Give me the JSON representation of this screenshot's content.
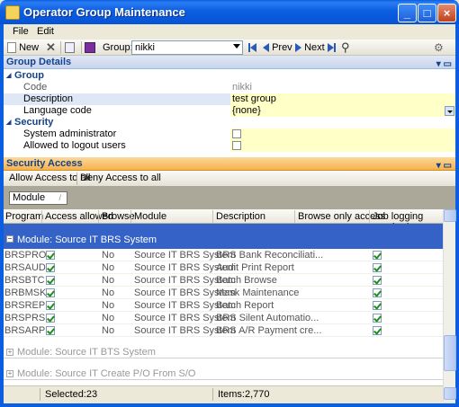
{
  "window": {
    "title": "Operator Group Maintenance"
  },
  "menu": {
    "file": "File",
    "edit": "Edit"
  },
  "toolbar": {
    "new_label": "New",
    "group_label": "Group:",
    "group_value": "nikki",
    "prev_label": "Prev",
    "next_label": "Next"
  },
  "group_details": {
    "header": "Group Details",
    "cat_group": "Group",
    "code_label": "Code",
    "code_value": "nikki",
    "desc_label": "Description",
    "desc_value": "test group",
    "lang_label": "Language code",
    "lang_value": "{none}",
    "cat_security": "Security",
    "sysadmin_label": "System administrator",
    "logout_label": "Allowed to logout users"
  },
  "security_access": {
    "header": "Security Access",
    "allow_all": "Allow Access to all",
    "deny_all": "Deny Access to all",
    "group_chip": "Module",
    "columns": [
      "Program",
      "Access allowed",
      "Browse",
      "Module",
      "Description",
      "Browse only access",
      "Job logging required"
    ],
    "group_expanded": "Module: Source IT BRS System",
    "rows": [
      {
        "program": "BRSPRO",
        "browse": "No",
        "module": "Source IT BRS System",
        "description": "BRS Bank Reconciliati..."
      },
      {
        "program": "BRSAUD",
        "browse": "No",
        "module": "Source IT BRS System",
        "description": "Audit Print Report"
      },
      {
        "program": "BRSBTC",
        "browse": "No",
        "module": "Source IT BRS System",
        "description": "Batch Browse"
      },
      {
        "program": "BRBMSK",
        "browse": "No",
        "module": "Source IT BRS System",
        "description": "Mask Maintenance"
      },
      {
        "program": "BRSREP",
        "browse": "No",
        "module": "Source IT BRS System",
        "description": "Batch Report"
      },
      {
        "program": "BRSPRS",
        "browse": "No",
        "module": "Source IT BRS System",
        "description": "BRS Silent Automatio..."
      },
      {
        "program": "BRSARP",
        "browse": "No",
        "module": "Source IT BRS System",
        "description": "BRS A/R Payment cre..."
      }
    ],
    "group_collapsed_1": "Module: Source IT BTS System",
    "group_collapsed_2": "Module: Source IT Create P/O From S/O"
  },
  "status": {
    "selected": "Selected:23",
    "items": "Items:2,770"
  }
}
